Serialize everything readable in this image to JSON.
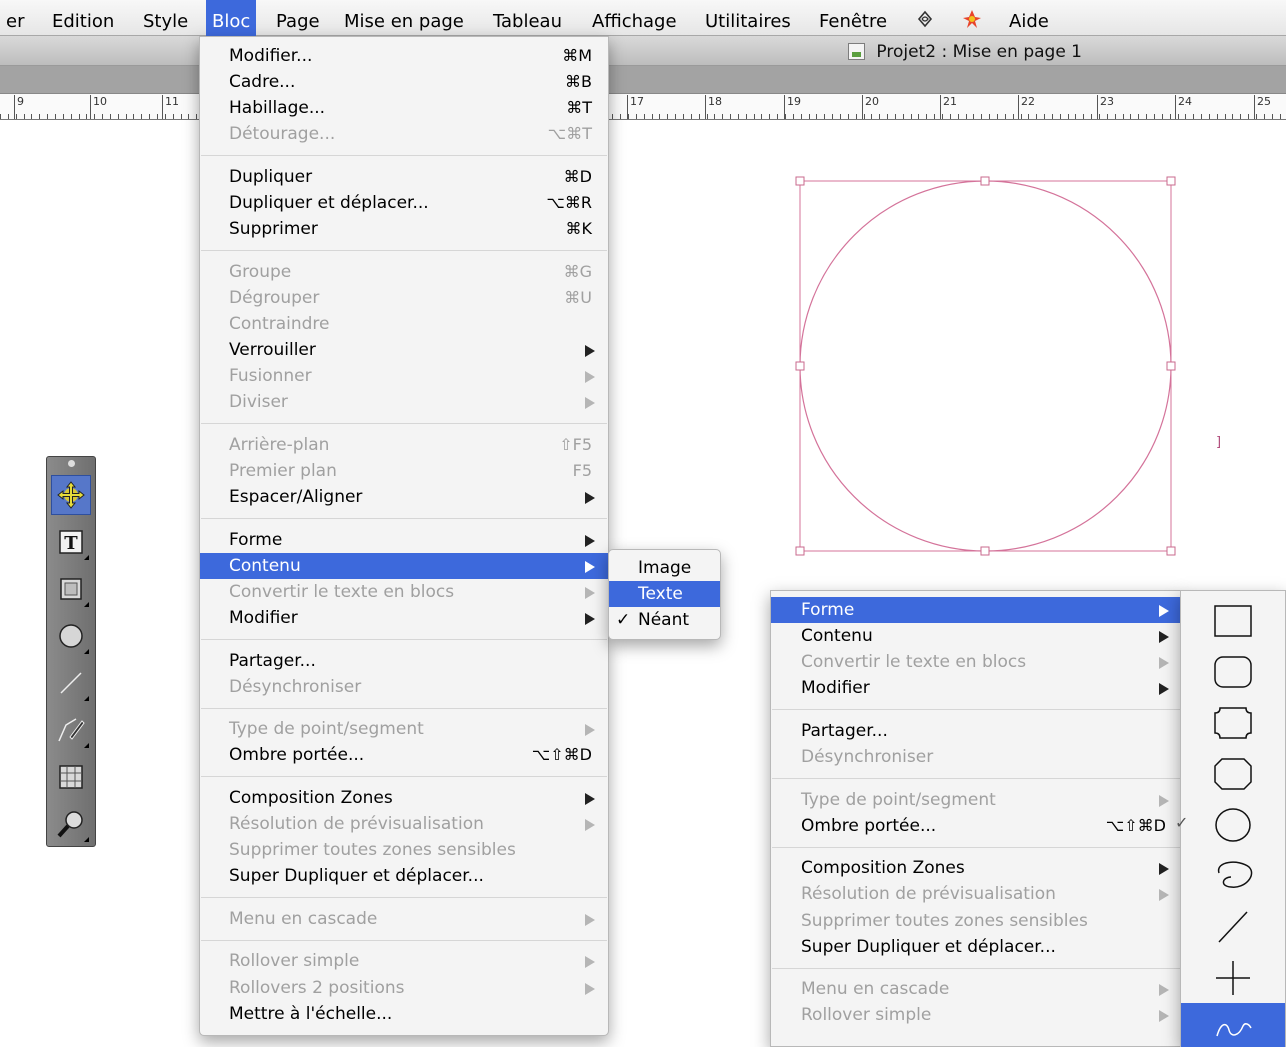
{
  "menubar": {
    "items": [
      {
        "label": "er"
      },
      {
        "label": "Edition"
      },
      {
        "label": "Style"
      },
      {
        "label": "Bloc"
      },
      {
        "label": "Page"
      },
      {
        "label": "Mise en page"
      },
      {
        "label": "Tableau"
      },
      {
        "label": "Affichage"
      },
      {
        "label": "Utilitaires"
      },
      {
        "label": "Fenêtre"
      },
      {
        "label": "Aide"
      }
    ],
    "active": "Bloc",
    "icons": [
      "script-icon",
      "xtension-icon"
    ],
    "accent_color": "#3d69dc"
  },
  "window": {
    "title": "Projet2 : Mise en page 1"
  },
  "ruler": {
    "numbers": [
      "9",
      "10",
      "11",
      "17",
      "18",
      "19",
      "20",
      "21",
      "22",
      "23",
      "24",
      "25"
    ]
  },
  "canvas": {
    "stray_text": "]",
    "shape_stroke_color": "#d4739a",
    "handle_color": "#c86a8e"
  },
  "main_menu": {
    "items": [
      {
        "label": "Modifier...",
        "shortcut": "⌘M",
        "enabled": true
      },
      {
        "label": "Cadre...",
        "shortcut": "⌘B",
        "enabled": true
      },
      {
        "label": "Habillage...",
        "shortcut": "⌘T",
        "enabled": true
      },
      {
        "label": "Détourage...",
        "shortcut": "⌥⌘T",
        "enabled": false
      },
      {
        "label": "Dupliquer",
        "shortcut": "⌘D",
        "enabled": true
      },
      {
        "label": "Dupliquer et déplacer...",
        "shortcut": "⌥⌘R",
        "enabled": true
      },
      {
        "label": "Supprimer",
        "shortcut": "⌘K",
        "enabled": true
      },
      {
        "label": "Groupe",
        "shortcut": "⌘G",
        "enabled": false
      },
      {
        "label": "Dégrouper",
        "shortcut": "⌘U",
        "enabled": false
      },
      {
        "label": "Contraindre",
        "shortcut": "",
        "enabled": false
      },
      {
        "label": "Verrouiller",
        "shortcut": "",
        "enabled": true,
        "submenu": true
      },
      {
        "label": "Fusionner",
        "shortcut": "",
        "enabled": false,
        "submenu": true
      },
      {
        "label": "Diviser",
        "shortcut": "",
        "enabled": false,
        "submenu": true
      },
      {
        "label": "Arrière-plan",
        "shortcut": "⇧F5",
        "enabled": false
      },
      {
        "label": "Premier plan",
        "shortcut": "F5",
        "enabled": false
      },
      {
        "label": "Espacer/Aligner",
        "shortcut": "",
        "enabled": true,
        "submenu": true
      },
      {
        "label": "Forme",
        "shortcut": "",
        "enabled": true,
        "submenu": true
      },
      {
        "label": "Contenu",
        "shortcut": "",
        "enabled": true,
        "submenu": true,
        "highlighted": true
      },
      {
        "label": "Convertir le texte en blocs",
        "shortcut": "",
        "enabled": false,
        "submenu": true
      },
      {
        "label": "Modifier",
        "shortcut": "",
        "enabled": true,
        "submenu": true
      },
      {
        "label": "Partager...",
        "shortcut": "",
        "enabled": true
      },
      {
        "label": "Désynchroniser",
        "shortcut": "",
        "enabled": false
      },
      {
        "label": "Type de point/segment",
        "shortcut": "",
        "enabled": false,
        "submenu": true
      },
      {
        "label": "Ombre portée...",
        "shortcut": "⌥⇧⌘D",
        "enabled": true
      },
      {
        "label": "Composition Zones",
        "shortcut": "",
        "enabled": true,
        "submenu": true
      },
      {
        "label": "Résolution de prévisualisation",
        "shortcut": "",
        "enabled": false,
        "submenu": true
      },
      {
        "label": "Supprimer toutes zones sensibles",
        "shortcut": "",
        "enabled": false
      },
      {
        "label": "Super Dupliquer et déplacer...",
        "shortcut": "",
        "enabled": true
      },
      {
        "label": "Menu en cascade",
        "shortcut": "",
        "enabled": false,
        "submenu": true
      },
      {
        "label": "Rollover simple",
        "shortcut": "",
        "enabled": false,
        "submenu": true
      },
      {
        "label": "Rollovers 2 positions",
        "shortcut": "",
        "enabled": false,
        "submenu": true
      },
      {
        "label": "Mettre à l'échelle...",
        "shortcut": "",
        "enabled": true
      }
    ]
  },
  "contenu_submenu": {
    "items": [
      {
        "label": "Image",
        "checked": false
      },
      {
        "label": "Texte",
        "checked": false,
        "highlighted": true
      },
      {
        "label": "Néant",
        "checked": true
      }
    ]
  },
  "second_menu": {
    "items": [
      {
        "label": "Forme",
        "enabled": true,
        "submenu": true,
        "highlighted": true
      },
      {
        "label": "Contenu",
        "enabled": true,
        "submenu": true
      },
      {
        "label": "Convertir le texte en blocs",
        "enabled": false,
        "submenu": true
      },
      {
        "label": "Modifier",
        "enabled": true,
        "submenu": true
      },
      {
        "label": "Partager...",
        "enabled": true
      },
      {
        "label": "Désynchroniser",
        "enabled": false
      },
      {
        "label": "Type de point/segment",
        "enabled": false,
        "submenu": true
      },
      {
        "label": "Ombre portée...",
        "enabled": true,
        "shortcut": "⌥⇧⌘D"
      },
      {
        "label": "Composition Zones",
        "enabled": true,
        "submenu": true
      },
      {
        "label": "Résolution de prévisualisation",
        "enabled": false,
        "submenu": true
      },
      {
        "label": "Supprimer toutes zones sensibles",
        "enabled": false
      },
      {
        "label": "Super Dupliquer et déplacer...",
        "enabled": true
      },
      {
        "label": "Menu en cascade",
        "enabled": false,
        "submenu": true
      },
      {
        "label": "Rollover simple",
        "enabled": false,
        "submenu": true
      }
    ]
  },
  "shape_submenu": {
    "items": [
      {
        "icon": "rectangle-shape-icon"
      },
      {
        "icon": "rounded-rectangle-shape-icon"
      },
      {
        "icon": "concave-corner-rectangle-shape-icon"
      },
      {
        "icon": "beveled-corner-rectangle-shape-icon"
      },
      {
        "icon": "oval-shape-icon",
        "checked": true
      },
      {
        "icon": "bezier-box-shape-icon"
      },
      {
        "icon": "line-shape-icon"
      },
      {
        "icon": "orthogonal-line-shape-icon"
      },
      {
        "icon": "bezier-line-shape-icon",
        "selected": true
      }
    ],
    "check_mark": "✓"
  },
  "tool_palette": {
    "tools": [
      {
        "icon": "item-tool-icon",
        "selected": true
      },
      {
        "icon": "text-content-tool-icon"
      },
      {
        "icon": "picture-content-tool-icon"
      },
      {
        "icon": "oval-box-tool-icon"
      },
      {
        "icon": "line-tool-icon"
      },
      {
        "icon": "bezier-pen-tool-icon"
      },
      {
        "icon": "table-tool-icon"
      },
      {
        "icon": "zoom-tool-icon"
      }
    ]
  }
}
